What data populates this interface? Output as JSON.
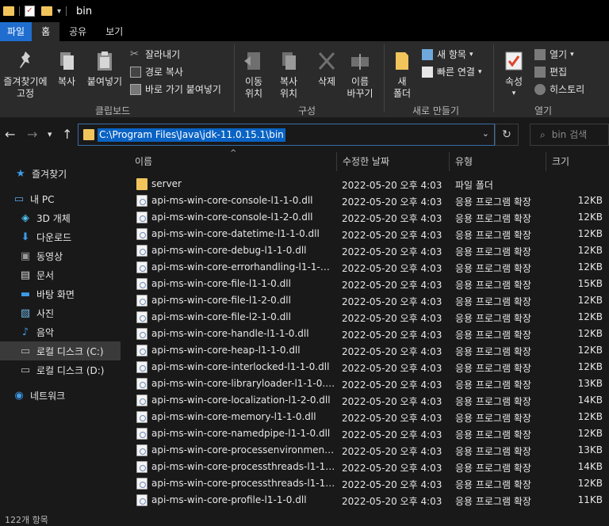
{
  "window": {
    "title": "bin"
  },
  "ribbon_tabs": [
    "파일",
    "홈",
    "공유",
    "보기"
  ],
  "ribbon": {
    "clipboard": {
      "pin_label_1": "즐겨찾기에",
      "pin_label_2": "고정",
      "copy_label": "복사",
      "paste_label": "붙여넣기",
      "cut_label": "잘라내기",
      "copy_path_label": "경로 복사",
      "paste_shortcut_label": "바로 가기 붙여넣기",
      "group": "클립보드"
    },
    "organize": {
      "move_1": "이동",
      "move_2": "위치",
      "copy_1": "복사",
      "copy_2": "위치",
      "delete": "삭제",
      "rename_1": "이름",
      "rename_2": "바꾸기",
      "group": "구성"
    },
    "new": {
      "new_folder_1": "새",
      "new_folder_2": "폴더",
      "new_item": "새 항목",
      "easy_access": "빠른 연결",
      "group": "새로 만들기"
    },
    "open": {
      "properties": "속성",
      "open": "열기",
      "edit": "편집",
      "history": "히스토리",
      "group": "열기"
    }
  },
  "address": {
    "path": "C:\\Program Files\\Java\\jdk-11.0.15.1\\bin",
    "search_placeholder": "bin 검색"
  },
  "nav": [
    {
      "label": "즐겨찾기",
      "icon": "star-icon",
      "color": "#3d9be9"
    },
    {
      "label": "내 PC",
      "icon": "pc-icon",
      "color": "#5aa6e8"
    },
    {
      "label": "3D 개체",
      "icon": "cube-icon",
      "color": "#4fc3f7"
    },
    {
      "label": "다운로드",
      "icon": "download-icon",
      "color": "#3d9be9"
    },
    {
      "label": "동영상",
      "icon": "video-icon",
      "color": "#9b9b9b"
    },
    {
      "label": "문서",
      "icon": "document-icon",
      "color": "#d8d8d8"
    },
    {
      "label": "바탕 화면",
      "icon": "desktop-icon",
      "color": "#3d9be9"
    },
    {
      "label": "사진",
      "icon": "pictures-icon",
      "color": "#6fb6e8"
    },
    {
      "label": "음악",
      "icon": "music-icon",
      "color": "#3d9be9"
    },
    {
      "label": "로컬 디스크 (C:)",
      "icon": "drive-icon",
      "color": "#bdbdbd"
    },
    {
      "label": "로컬 디스크 (D:)",
      "icon": "drive-icon",
      "color": "#bdbdbd"
    },
    {
      "label": "네트워크",
      "icon": "network-icon",
      "color": "#3d9be9"
    }
  ],
  "columns": {
    "name": "이름",
    "date": "수정한 날짜",
    "type": "유형",
    "size": "크기"
  },
  "files": [
    {
      "name": "server",
      "date": "2022-05-20 오후 4:03",
      "type": "파일 폴더",
      "size": "",
      "kind": "folder"
    },
    {
      "name": "api-ms-win-core-console-l1-1-0.dll",
      "date": "2022-05-20 오후 4:03",
      "type": "응용 프로그램 확장",
      "size": "12KB",
      "kind": "dll"
    },
    {
      "name": "api-ms-win-core-console-l1-2-0.dll",
      "date": "2022-05-20 오후 4:03",
      "type": "응용 프로그램 확장",
      "size": "12KB",
      "kind": "dll"
    },
    {
      "name": "api-ms-win-core-datetime-l1-1-0.dll",
      "date": "2022-05-20 오후 4:03",
      "type": "응용 프로그램 확장",
      "size": "12KB",
      "kind": "dll"
    },
    {
      "name": "api-ms-win-core-debug-l1-1-0.dll",
      "date": "2022-05-20 오후 4:03",
      "type": "응용 프로그램 확장",
      "size": "12KB",
      "kind": "dll"
    },
    {
      "name": "api-ms-win-core-errorhandling-l1-1-0.dll",
      "date": "2022-05-20 오후 4:03",
      "type": "응용 프로그램 확장",
      "size": "12KB",
      "kind": "dll"
    },
    {
      "name": "api-ms-win-core-file-l1-1-0.dll",
      "date": "2022-05-20 오후 4:03",
      "type": "응용 프로그램 확장",
      "size": "15KB",
      "kind": "dll"
    },
    {
      "name": "api-ms-win-core-file-l1-2-0.dll",
      "date": "2022-05-20 오후 4:03",
      "type": "응용 프로그램 확장",
      "size": "12KB",
      "kind": "dll"
    },
    {
      "name": "api-ms-win-core-file-l2-1-0.dll",
      "date": "2022-05-20 오후 4:03",
      "type": "응용 프로그램 확장",
      "size": "12KB",
      "kind": "dll"
    },
    {
      "name": "api-ms-win-core-handle-l1-1-0.dll",
      "date": "2022-05-20 오후 4:03",
      "type": "응용 프로그램 확장",
      "size": "12KB",
      "kind": "dll"
    },
    {
      "name": "api-ms-win-core-heap-l1-1-0.dll",
      "date": "2022-05-20 오후 4:03",
      "type": "응용 프로그램 확장",
      "size": "12KB",
      "kind": "dll"
    },
    {
      "name": "api-ms-win-core-interlocked-l1-1-0.dll",
      "date": "2022-05-20 오후 4:03",
      "type": "응용 프로그램 확장",
      "size": "12KB",
      "kind": "dll"
    },
    {
      "name": "api-ms-win-core-libraryloader-l1-1-0.dll",
      "date": "2022-05-20 오후 4:03",
      "type": "응용 프로그램 확장",
      "size": "13KB",
      "kind": "dll"
    },
    {
      "name": "api-ms-win-core-localization-l1-2-0.dll",
      "date": "2022-05-20 오후 4:03",
      "type": "응용 프로그램 확장",
      "size": "14KB",
      "kind": "dll"
    },
    {
      "name": "api-ms-win-core-memory-l1-1-0.dll",
      "date": "2022-05-20 오후 4:03",
      "type": "응용 프로그램 확장",
      "size": "12KB",
      "kind": "dll"
    },
    {
      "name": "api-ms-win-core-namedpipe-l1-1-0.dll",
      "date": "2022-05-20 오후 4:03",
      "type": "응용 프로그램 확장",
      "size": "12KB",
      "kind": "dll"
    },
    {
      "name": "api-ms-win-core-processenvironment-l1...",
      "date": "2022-05-20 오후 4:03",
      "type": "응용 프로그램 확장",
      "size": "13KB",
      "kind": "dll"
    },
    {
      "name": "api-ms-win-core-processthreads-l1-1-0....",
      "date": "2022-05-20 오후 4:03",
      "type": "응용 프로그램 확장",
      "size": "14KB",
      "kind": "dll"
    },
    {
      "name": "api-ms-win-core-processthreads-l1-1-1....",
      "date": "2022-05-20 오후 4:03",
      "type": "응용 프로그램 확장",
      "size": "12KB",
      "kind": "dll"
    },
    {
      "name": "api-ms-win-core-profile-l1-1-0.dll",
      "date": "2022-05-20 오후 4:03",
      "type": "응용 프로그램 확장",
      "size": "11KB",
      "kind": "dll"
    }
  ],
  "status": {
    "item_count": "122개 항목"
  }
}
